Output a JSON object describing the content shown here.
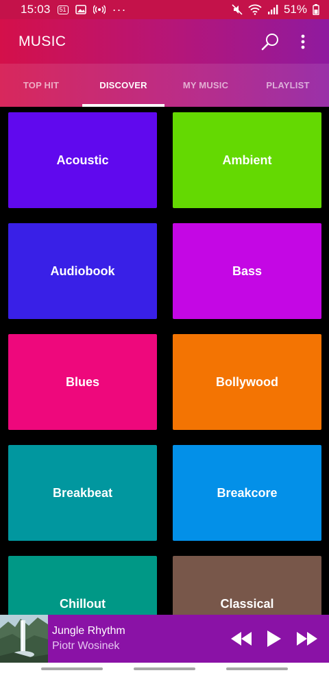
{
  "status_bar": {
    "time": "15:03",
    "notif_badge": "51",
    "overflow": "···",
    "battery": "51%",
    "icons": [
      "image-icon",
      "cast-signal-icon",
      "mute-icon",
      "wifi-icon",
      "cell-signal-icon",
      "battery-icon"
    ]
  },
  "header": {
    "title": "MUSIC",
    "icons": [
      "search-icon",
      "more-vert-icon"
    ],
    "gradient": [
      "#d4104a",
      "#8f1a9f"
    ]
  },
  "tabs": [
    {
      "label": "TOP HIT",
      "active": false
    },
    {
      "label": "DISCOVER",
      "active": true
    },
    {
      "label": "MY MUSIC",
      "active": false
    },
    {
      "label": "PLAYLIST",
      "active": false
    }
  ],
  "genres": [
    {
      "label": "Acoustic",
      "color": "#6009ee"
    },
    {
      "label": "Ambient",
      "color": "#64d902"
    },
    {
      "label": "Audiobook",
      "color": "#3920e7"
    },
    {
      "label": "Bass",
      "color": "#c407e4"
    },
    {
      "label": "Blues",
      "color": "#ee087c"
    },
    {
      "label": "Bollywood",
      "color": "#f37403"
    },
    {
      "label": "Breakbeat",
      "color": "#01979f"
    },
    {
      "label": "Breakcore",
      "color": "#0390e8"
    },
    {
      "label": "Chillout",
      "color": "#009886"
    },
    {
      "label": "Classical",
      "color": "#78574a"
    }
  ],
  "player": {
    "title": "Jungle Rhythm",
    "artist": "Piotr Wosinek",
    "background": "#8a12a6",
    "icons": [
      "album-art",
      "rewind-icon",
      "play-icon",
      "fast-forward-icon"
    ]
  }
}
